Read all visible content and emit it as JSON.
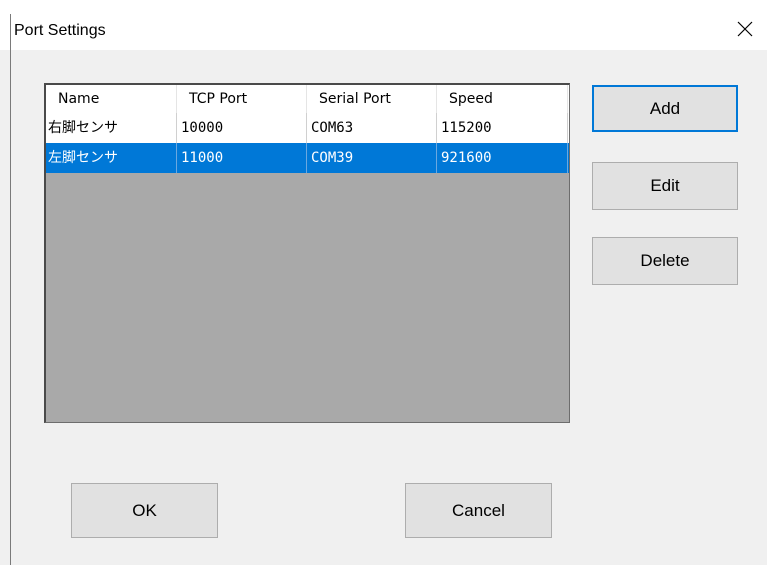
{
  "window": {
    "title": "Port Settings"
  },
  "table": {
    "columns": [
      "Name",
      "TCP Port",
      "Serial Port",
      "Speed"
    ],
    "rows": [
      {
        "name": "右脚センサ",
        "tcp_port": "10000",
        "serial_port": "COM63",
        "speed": "115200",
        "selected": false
      },
      {
        "name": "左脚センサ",
        "tcp_port": "11000",
        "serial_port": "COM39",
        "speed": "921600",
        "selected": true
      }
    ]
  },
  "buttons": {
    "add": "Add",
    "edit": "Edit",
    "delete": "Delete",
    "ok": "OK",
    "cancel": "Cancel"
  },
  "colors": {
    "selection": "#0078d7",
    "list_background": "#a9a9a9",
    "dialog_background": "#f0f0f0"
  },
  "icons": {
    "close": "close-icon"
  }
}
